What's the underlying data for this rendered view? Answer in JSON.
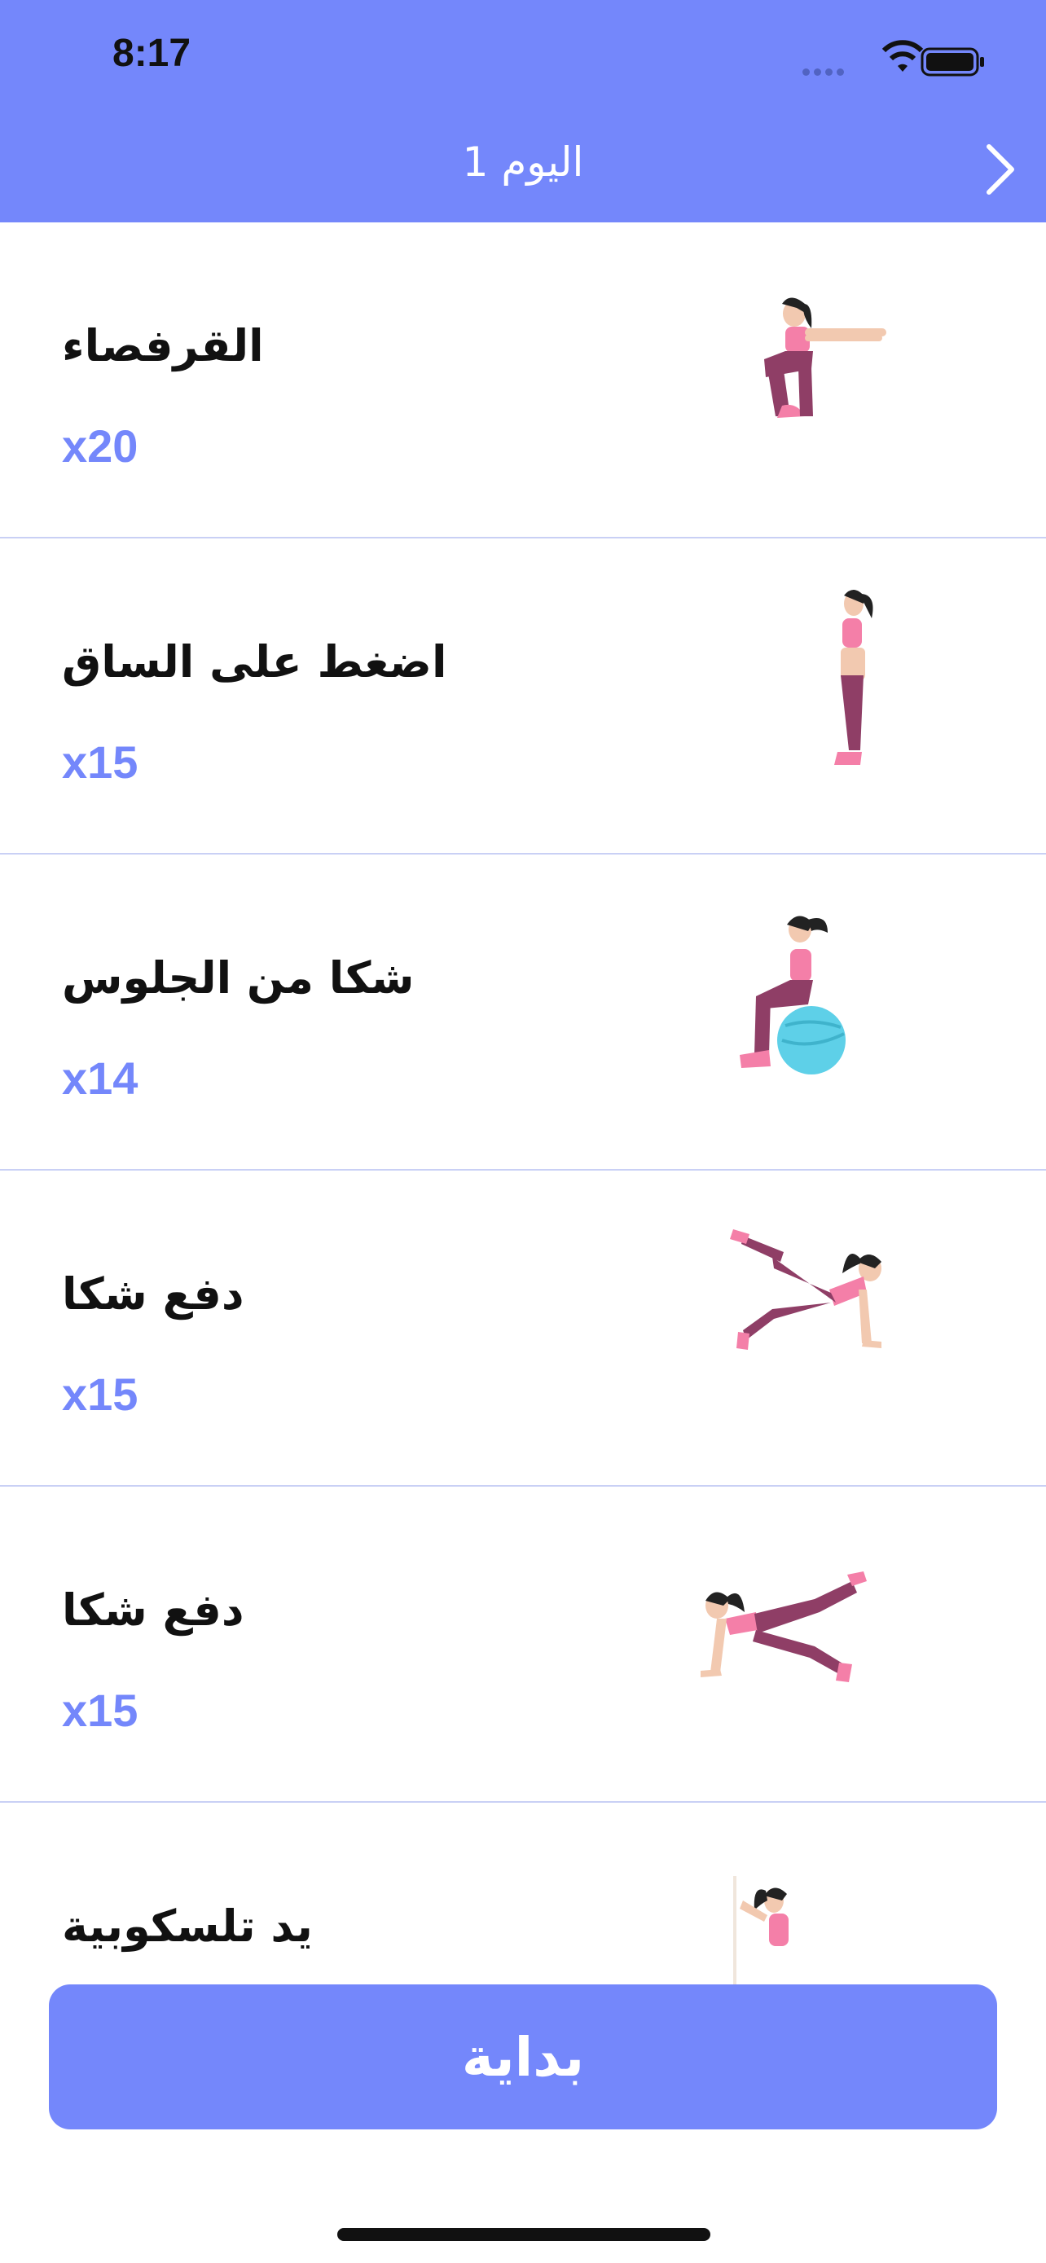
{
  "status_bar": {
    "time": "8:17"
  },
  "header": {
    "title": "اليوم 1"
  },
  "exercises": [
    {
      "name": "القرفصاء",
      "count": "x20",
      "icon": "squat-illustration"
    },
    {
      "name": "اضغط على الساق",
      "count": "x15",
      "icon": "calf-raise-illustration"
    },
    {
      "name": "شكا من الجلوس",
      "count": "x14",
      "icon": "seated-ball-illustration"
    },
    {
      "name": "دفع شكا",
      "count": "x15",
      "icon": "plank-kickback-left-illustration"
    },
    {
      "name": "دفع شكا",
      "count": "x15",
      "icon": "plank-kickback-right-illustration"
    },
    {
      "name": "يد تلسكوبية",
      "count": "",
      "icon": "wall-pushup-illustration"
    }
  ],
  "start_button": {
    "label": "بداية"
  },
  "colors": {
    "accent": "#7487FB",
    "divider": "#c9d0f5",
    "pink": "#F47FA8",
    "plum": "#8F3E66"
  }
}
